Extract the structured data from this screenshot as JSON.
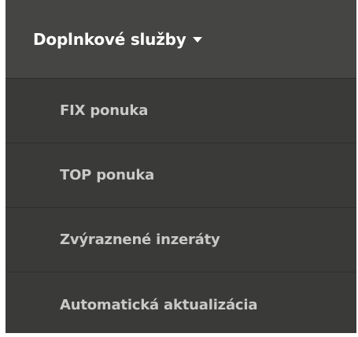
{
  "menu": {
    "header_label": "Doplnkové služby",
    "items": [
      {
        "label": "FIX ponuka"
      },
      {
        "label": "TOP ponuka"
      },
      {
        "label": "Zvýraznené inzeráty"
      },
      {
        "label": "Automatická aktualizácia"
      }
    ]
  },
  "colors": {
    "background": "#3a3a38",
    "header_background": "#454543",
    "header_text": "#ffffff",
    "item_text": "#c9c9c7",
    "divider": "#2f2f2d"
  },
  "icons": {
    "header_caret": "caret-down-icon"
  }
}
